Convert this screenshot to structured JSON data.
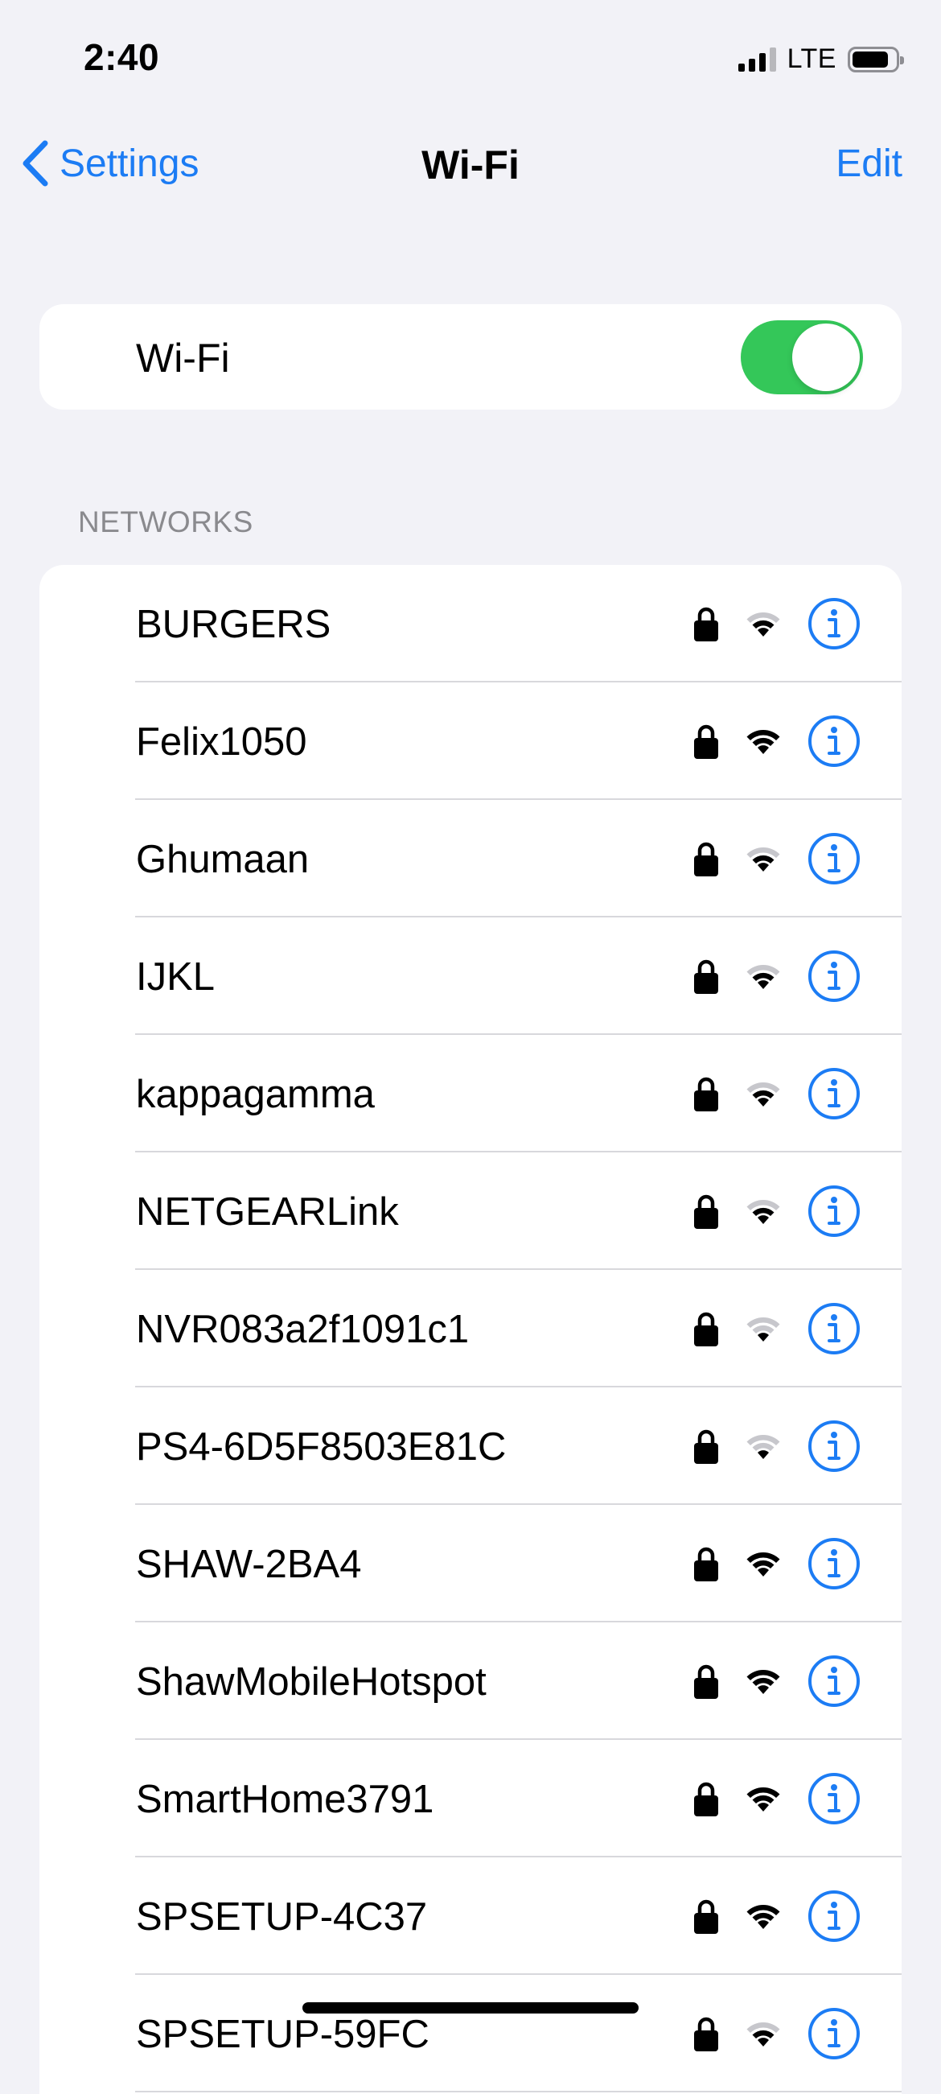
{
  "status_bar": {
    "time": "2:40",
    "signal_bars": 3,
    "signal_bars_total": 4,
    "network_type": "LTE",
    "battery_level": 0.85
  },
  "nav": {
    "back_label": "Settings",
    "title": "Wi-Fi",
    "edit_label": "Edit"
  },
  "wifi_toggle": {
    "label": "Wi-Fi",
    "enabled": true,
    "on_color": "#34c759"
  },
  "networks": {
    "header": "NETWORKS",
    "items": [
      {
        "name": "BURGERS",
        "secured": true,
        "signal_bars": 2
      },
      {
        "name": "Felix1050",
        "secured": true,
        "signal_bars": 3
      },
      {
        "name": "Ghumaan",
        "secured": true,
        "signal_bars": 2
      },
      {
        "name": "IJKL",
        "secured": true,
        "signal_bars": 2
      },
      {
        "name": "kappagamma",
        "secured": true,
        "signal_bars": 2
      },
      {
        "name": "NETGEARLink",
        "secured": true,
        "signal_bars": 2
      },
      {
        "name": "NVR083a2f1091c1",
        "secured": true,
        "signal_bars": 1
      },
      {
        "name": "PS4-6D5F8503E81C",
        "secured": true,
        "signal_bars": 1
      },
      {
        "name": "SHAW-2BA4",
        "secured": true,
        "signal_bars": 3
      },
      {
        "name": "ShawMobileHotspot",
        "secured": true,
        "signal_bars": 3
      },
      {
        "name": "SmartHome3791",
        "secured": true,
        "signal_bars": 3
      },
      {
        "name": "SPSETUP-4C37",
        "secured": true,
        "signal_bars": 3
      },
      {
        "name": "SPSETUP-59FC",
        "secured": true,
        "signal_bars": 2
      }
    ]
  },
  "colors": {
    "accent": "#1c7cf4",
    "background": "#f2f2f7",
    "wifi_active": "#000000",
    "wifi_inactive": "#c7c7cc"
  },
  "icons": {
    "back": "chevron-left-icon",
    "lock": "lock-icon",
    "wifi": "wifi-signal-icon",
    "info": "info-circle-icon"
  }
}
